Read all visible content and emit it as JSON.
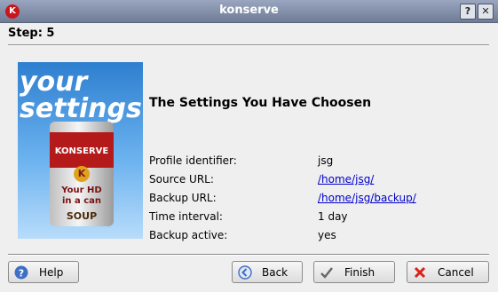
{
  "window": {
    "title": "konserve",
    "app_icon": "K",
    "help_glyph": "?",
    "close_glyph": "✕"
  },
  "step": "Step: 5",
  "image": {
    "line1": "your",
    "line2": "settings",
    "brand": "KONSERVE",
    "logo": "K",
    "tag1": "Your HD",
    "tag2": "in a can",
    "soup": "SOUP"
  },
  "heading": "The Settings You Have Choosen",
  "settings": [
    {
      "label": "Profile identifier:",
      "value": "jsg"
    },
    {
      "label": "Source URL:",
      "value": "/home/jsg/"
    },
    {
      "label": "Backup URL:",
      "value": "/home/jsg/backup/"
    },
    {
      "label": "Time interval:",
      "value": "1 day"
    },
    {
      "label": "Backup active:",
      "value": "yes"
    }
  ],
  "buttons": {
    "help": "Help",
    "back": "Back",
    "finish": "Finish",
    "cancel": "Cancel"
  },
  "icons": {
    "help": "help-icon",
    "back": "back-arrow-icon",
    "finish": "checkmark-icon",
    "cancel": "cancel-x-icon"
  }
}
